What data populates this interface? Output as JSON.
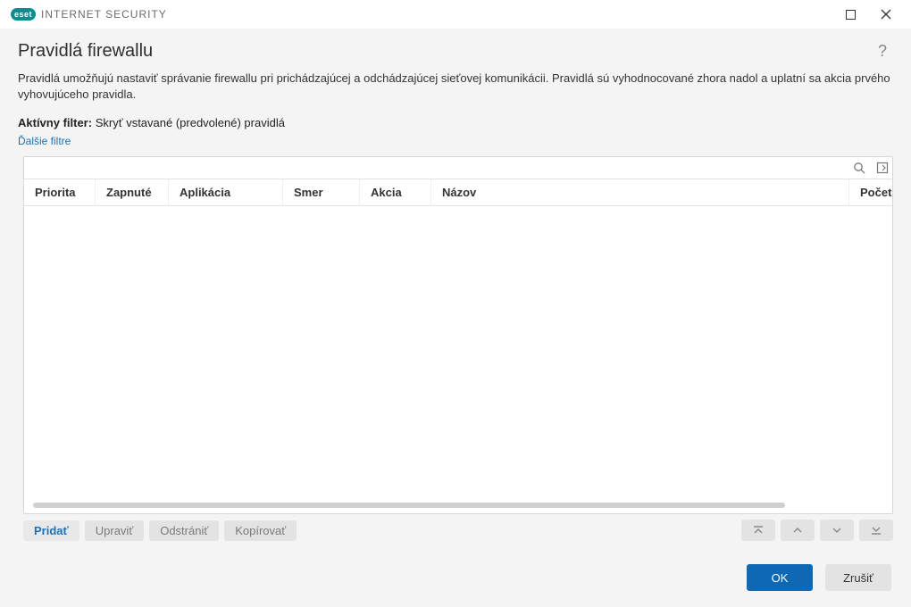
{
  "app": {
    "brand_badge": "eset",
    "brand_product": "INTERNET SECURITY"
  },
  "header": {
    "title": "Pravidlá firewallu",
    "description": "Pravidlá umožňujú nastaviť správanie firewallu pri prichádzajúcej a odchádzajúcej sieťovej komunikácii. Pravidlá sú vyhodnocované zhora nadol a uplatní sa akcia prvého vyhovujúceho pravidla.",
    "active_filter_label": "Aktívny filter:",
    "active_filter_value": "Skryť vstavané (predvolené) pravidlá",
    "more_filters": "Ďalšie filtre"
  },
  "table": {
    "columns": {
      "priority": "Priorita",
      "enabled": "Zapnuté",
      "application": "Aplikácia",
      "direction": "Smer",
      "action": "Akcia",
      "name": "Názov",
      "count": "Počet u"
    },
    "rows": []
  },
  "actions": {
    "add": "Pridať",
    "edit": "Upraviť",
    "delete": "Odstrániť",
    "copy": "Kopírovať"
  },
  "footer": {
    "ok": "OK",
    "cancel": "Zrušiť"
  }
}
